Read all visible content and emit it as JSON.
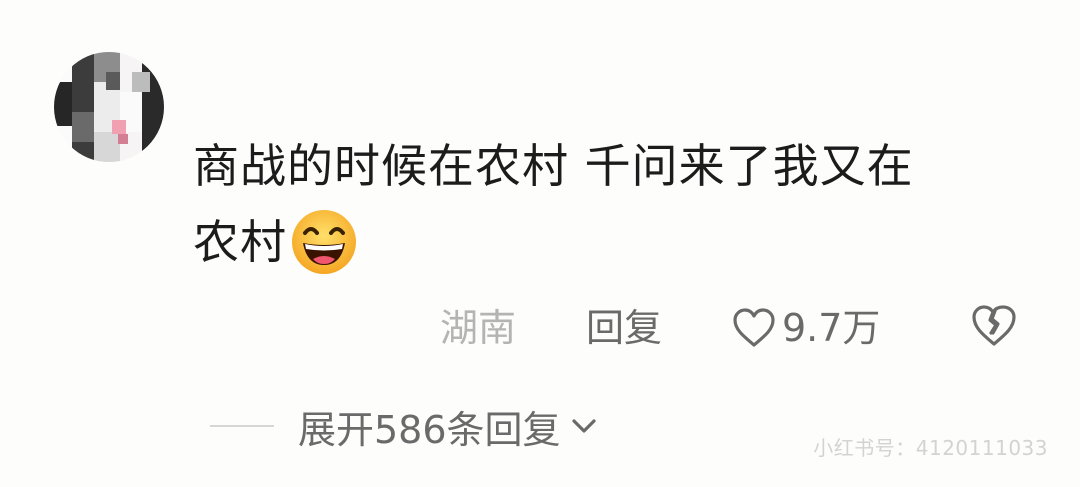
{
  "comment": {
    "text_line1": "商战的时候在农村 千问来了我又在",
    "text_line2": "农村",
    "emoji": "grinning-face-icon"
  },
  "meta": {
    "location": "湖南",
    "reply_label": "回复",
    "like_count": "9.7万"
  },
  "expand": {
    "label": "展开586条回复"
  },
  "watermark": {
    "text": "小红书号：4120111033"
  },
  "colors": {
    "text_primary": "#1c1c1c",
    "text_secondary": "#6a6a6a",
    "text_muted": "#b4b4b4",
    "background": "#fdfdfc"
  }
}
